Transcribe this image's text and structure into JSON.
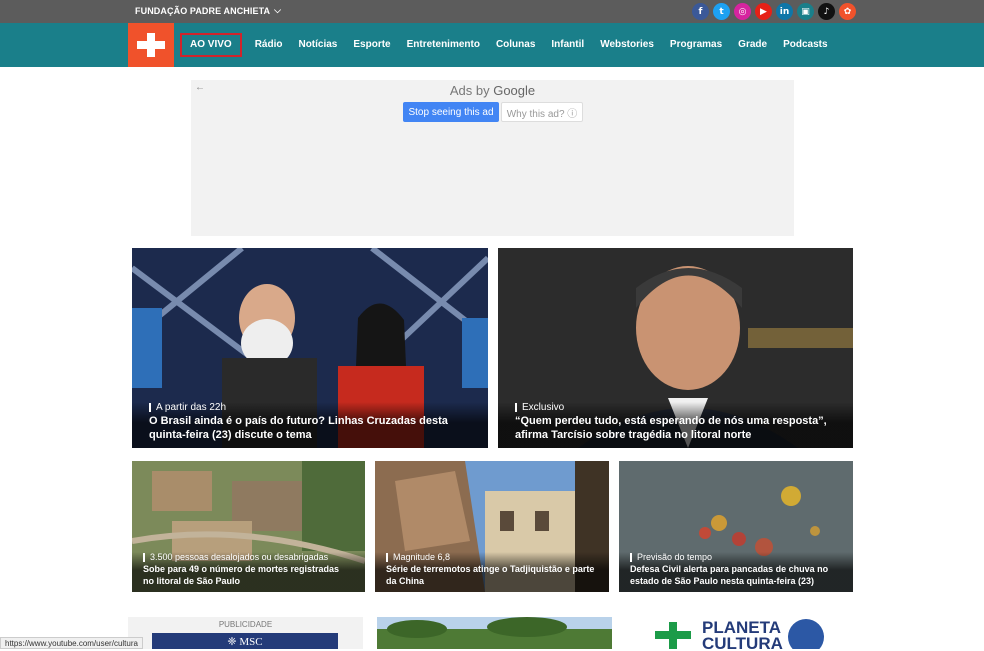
{
  "topbar": {
    "org_label": "FUNDAÇÃO PADRE ANCHIETA",
    "social": [
      {
        "icon": "facebook-icon",
        "glyph": "f",
        "color": "#3b5998"
      },
      {
        "icon": "twitter-icon",
        "glyph": "t",
        "color": "#1da1f2"
      },
      {
        "icon": "instagram-icon",
        "glyph": "◎",
        "color": "#d6249f"
      },
      {
        "icon": "youtube-icon",
        "glyph": "▶",
        "color": "#e62117"
      },
      {
        "icon": "linkedin-icon",
        "glyph": "in",
        "color": "#0e76a8"
      },
      {
        "icon": "app-icon",
        "glyph": "▣",
        "color": "#1a7f8a"
      },
      {
        "icon": "tiktok-icon",
        "glyph": "♪",
        "color": "#111111"
      },
      {
        "icon": "share-icon",
        "glyph": "✿",
        "color": "#f0522b"
      }
    ]
  },
  "nav": {
    "items": [
      "AO VIVO",
      "Rádio",
      "Notícias",
      "Esporte",
      "Entretenimento",
      "Colunas",
      "Infantil",
      "Webstories",
      "Programas",
      "Grade",
      "Podcasts"
    ]
  },
  "ad": {
    "ads_by": "Ads by",
    "google": "Google",
    "stop_label": "Stop seeing this ad",
    "why_label": "Why this ad? ⓘ"
  },
  "featured": [
    {
      "kicker": "A partir das 22h",
      "headline": "O Brasil ainda é o país do futuro? Linhas Cruzadas desta quinta-feira (23) discute o tema"
    },
    {
      "kicker": "Exclusivo",
      "headline": "“Quem perdeu tudo, está esperando de nós uma resposta”, afirma Tarcísio sobre tragédia no litoral norte"
    }
  ],
  "secondary": [
    {
      "kicker": "3.500 pessoas desalojados ou desabrigadas",
      "headline": "Sobe para 49 o número de mortes registradas no litoral de São Paulo"
    },
    {
      "kicker": "Magnitude 6,8",
      "headline": "Série de terremotos atinge o Tadjiquistão e parte da China"
    },
    {
      "kicker": "Previsão do tempo",
      "headline": "Defesa Civil alerta para pancadas de chuva no estado de São Paulo nesta quinta-feira (23)"
    }
  ],
  "bottom": {
    "publicidade": "PUBLICIDADE",
    "msc_text": "❈ MSC",
    "planeta_line1": "PLANETA",
    "planeta_line2": "CULTURA"
  },
  "statusbar": "https://www.youtube.com/user/cultura",
  "colors": {
    "topbar": "#5c5c5c",
    "navbar": "#1a7f8a",
    "logo": "#f0522b",
    "live_border": "#d0242b"
  }
}
